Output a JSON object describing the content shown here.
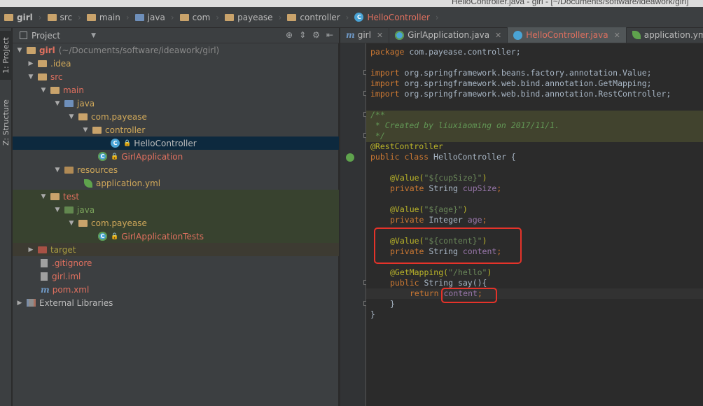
{
  "window": {
    "title": "HelloController.java - girl - [~/Documents/software/ideawork/girl]"
  },
  "breadcrumbs": [
    "girl",
    "src",
    "main",
    "java",
    "com",
    "payease",
    "controller",
    "HelloController"
  ],
  "left_tool_tabs": [
    "1: Project",
    "Z: Structure"
  ],
  "project_panel": {
    "title": "Project"
  },
  "tree": [
    {
      "label": "girl",
      "extra": "(~/Documents/software/ideawork/girl)",
      "icon": "folder-icon",
      "color": "red"
    },
    {
      "label": ".idea",
      "icon": "folder-icon",
      "color": "orange"
    },
    {
      "label": "src",
      "icon": "folder-icon",
      "color": "red"
    },
    {
      "label": "main",
      "icon": "folder-icon",
      "color": "red"
    },
    {
      "label": "java",
      "icon": "source-folder-icon",
      "color": "orange"
    },
    {
      "label": "com.payease",
      "icon": "package-icon",
      "color": "orange"
    },
    {
      "label": "controller",
      "icon": "package-icon",
      "color": "orange"
    },
    {
      "label": "HelloController",
      "icon": "class-icon",
      "color": "default"
    },
    {
      "label": "GirlApplication",
      "icon": "spring-class-icon",
      "color": "red"
    },
    {
      "label": "resources",
      "icon": "resources-folder-icon",
      "color": "orange"
    },
    {
      "label": "application.yml",
      "icon": "spring-yml-icon",
      "color": "orange"
    },
    {
      "label": "test",
      "icon": "folder-icon",
      "color": "red"
    },
    {
      "label": "java",
      "icon": "test-folder-icon",
      "color": "green"
    },
    {
      "label": "com.payease",
      "icon": "package-icon",
      "color": "orange"
    },
    {
      "label": "GirlApplicationTests",
      "icon": "spring-class-icon",
      "color": "red"
    },
    {
      "label": "target",
      "icon": "folder-icon",
      "color": "olive"
    },
    {
      "label": ".gitignore",
      "icon": "file-icon",
      "color": "red"
    },
    {
      "label": "girl.iml",
      "icon": "file-icon",
      "color": "red"
    },
    {
      "label": "pom.xml",
      "icon": "maven-icon",
      "color": "red"
    },
    {
      "label": "External Libraries",
      "icon": "libraries-icon",
      "color": "default"
    }
  ],
  "editor_tabs": [
    {
      "label": "girl",
      "icon": "maven-icon",
      "active": false
    },
    {
      "label": "GirlApplication.java",
      "icon": "spring-class-icon",
      "active": false
    },
    {
      "label": "HelloController.java",
      "icon": "class-icon",
      "active": true
    },
    {
      "label": "application.yml",
      "icon": "spring-yml-icon",
      "active": false
    }
  ],
  "code": {
    "l1": {
      "kw": "package",
      "rest": " com.payease.controller;"
    },
    "l3": {
      "kw": "import",
      "rest": " org.springframework.beans.factory.annotation.Value;"
    },
    "l4": {
      "kw": "import",
      "rest": " org.springframework.web.bind.annotation.GetMapping;"
    },
    "l5": {
      "kw": "import",
      "rest": " org.springframework.web.bind.annotation.RestController;"
    },
    "l7": "/**",
    "l8": " * Created by liuxiaoming on 2017/11/1.",
    "l9": " */",
    "l10": "@RestController",
    "l11": {
      "kw": "public class",
      "rest": " HelloController {"
    },
    "l13": {
      "ann": "@Value(",
      "str": "\"${cupSize}\"",
      "end": ")"
    },
    "l14": {
      "kw": "private",
      "type": " String ",
      "fld": "cupSize",
      "end": ";"
    },
    "l16": {
      "ann": "@Value(",
      "str": "\"${age}\"",
      "end": ")"
    },
    "l17": {
      "kw": "private",
      "type": " Integer ",
      "fld": "age",
      "end": ";"
    },
    "l19": {
      "ann": "@Value(",
      "str": "\"${content}\"",
      "end": ")"
    },
    "l20": {
      "kw": "private",
      "type": " String ",
      "fld": "content",
      "end": ";"
    },
    "l22": {
      "ann": "@GetMapping(",
      "str": "\"/hello\"",
      "end": ")"
    },
    "l23": {
      "kw": "public",
      "type": " String ",
      "fn": "say(){"
    },
    "l24": {
      "kw": "return",
      "fld": "content",
      "end": ";"
    },
    "l25": "}",
    "l26": "}"
  },
  "colors": {
    "highlight_box": "#e5332a",
    "keyword": "#cc7832",
    "string": "#6a8759",
    "annotation": "#bbb529",
    "field": "#9876aa",
    "comment": "#629755"
  }
}
